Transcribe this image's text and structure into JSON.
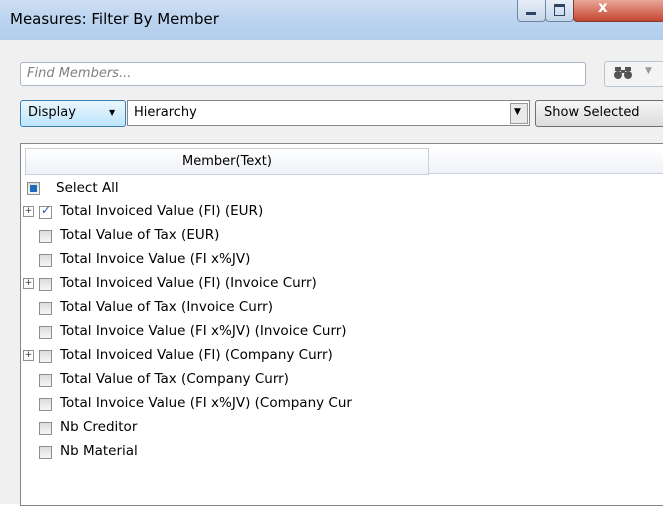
{
  "window": {
    "title": "Measures: Filter By Member",
    "close_glyph": "x"
  },
  "toolbar": {
    "search_placeholder": "Find Members...",
    "find_icon": "binoculars-icon",
    "display_label": "Display",
    "hierarchy_value": "Hierarchy",
    "show_selected_label": "Show Selected"
  },
  "list": {
    "column_header": "Member(Text)",
    "select_all": "Select All",
    "items": [
      {
        "label": "Total Invoiced Value (FI) (EUR)",
        "expandable": true,
        "checked": true
      },
      {
        "label": "Total Value of Tax (EUR)",
        "expandable": false,
        "checked": false
      },
      {
        "label": "Total Invoice Value (FI x%JV)",
        "expandable": false,
        "checked": false
      },
      {
        "label": "Total Invoiced Value (FI) (Invoice Curr)",
        "expandable": true,
        "checked": false
      },
      {
        "label": "Total Value of Tax (Invoice Curr)",
        "expandable": false,
        "checked": false
      },
      {
        "label": "Total Invoice Value (FI x%JV) (Invoice Curr)",
        "expandable": false,
        "checked": false
      },
      {
        "label": "Total Invoiced Value (FI) (Company Curr)",
        "expandable": true,
        "checked": false
      },
      {
        "label": "Total Value of Tax (Company Curr)",
        "expandable": false,
        "checked": false
      },
      {
        "label": "Total Invoice Value (FI x%JV) (Company Cur",
        "expandable": false,
        "checked": false
      },
      {
        "label": "Nb Creditor",
        "expandable": false,
        "checked": false
      },
      {
        "label": "Nb Material",
        "expandable": false,
        "checked": false
      }
    ]
  }
}
